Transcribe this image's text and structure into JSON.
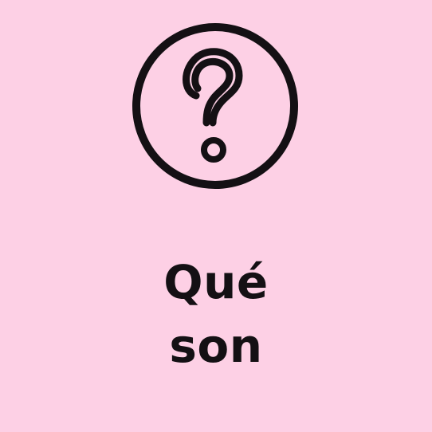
{
  "colors": {
    "background": "#fdd0e5",
    "ink": "#141014"
  },
  "icon": {
    "name": "question-mark-circle-icon"
  },
  "heading": {
    "line1": "Qué",
    "line2": "son"
  }
}
